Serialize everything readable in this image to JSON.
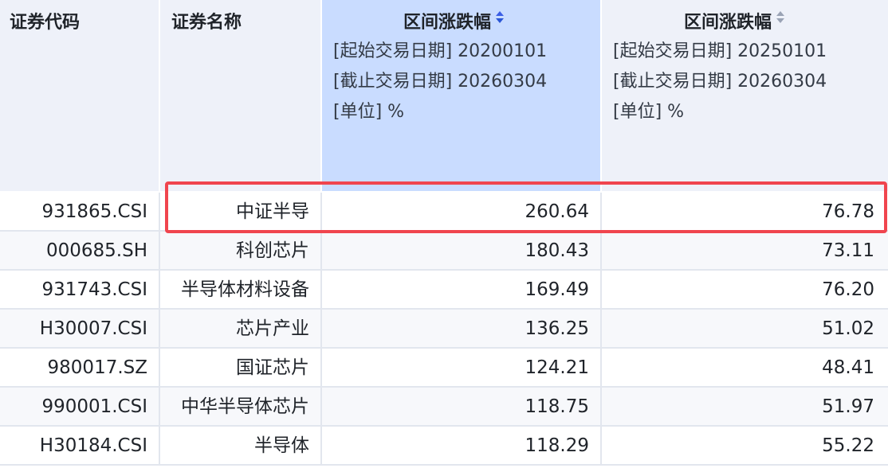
{
  "columns": {
    "code": {
      "title": "证券代码"
    },
    "name": {
      "title": "证券名称"
    },
    "range1": {
      "title": "区间涨跌幅",
      "start_label": "[起始交易日期] 20200101",
      "end_label": "[截止交易日期] 20260304",
      "unit_label": "[单位] %",
      "sort_icon": "sort-desc-active-icon"
    },
    "range2": {
      "title": "区间涨跌幅",
      "start_label": "[起始交易日期] 20250101",
      "end_label": "[截止交易日期] 20260304",
      "unit_label": "[单位] %",
      "sort_icon": "sort-icon"
    }
  },
  "rows": [
    {
      "code": "931865.CSI",
      "name": "中证半导",
      "v1": "260.64",
      "v2": "76.78"
    },
    {
      "code": "000685.SH",
      "name": "科创芯片",
      "v1": "180.43",
      "v2": "73.11"
    },
    {
      "code": "931743.CSI",
      "name": "半导体材料设备",
      "v1": "169.49",
      "v2": "76.20"
    },
    {
      "code": "H30007.CSI",
      "name": "芯片产业",
      "v1": "136.25",
      "v2": "51.02"
    },
    {
      "code": "980017.SZ",
      "name": "国证芯片",
      "v1": "124.21",
      "v2": "48.41"
    },
    {
      "code": "990001.CSI",
      "name": "中华半导体芯片",
      "v1": "118.75",
      "v2": "51.97"
    },
    {
      "code": "H30184.CSI",
      "name": "半导体",
      "v1": "118.29",
      "v2": "55.22"
    }
  ],
  "colors": {
    "header_bg": "#eef1f9",
    "selected_header_bg": "#c9dcff",
    "highlight_border": "#f0454e",
    "sort_active": "#2a56d6"
  }
}
